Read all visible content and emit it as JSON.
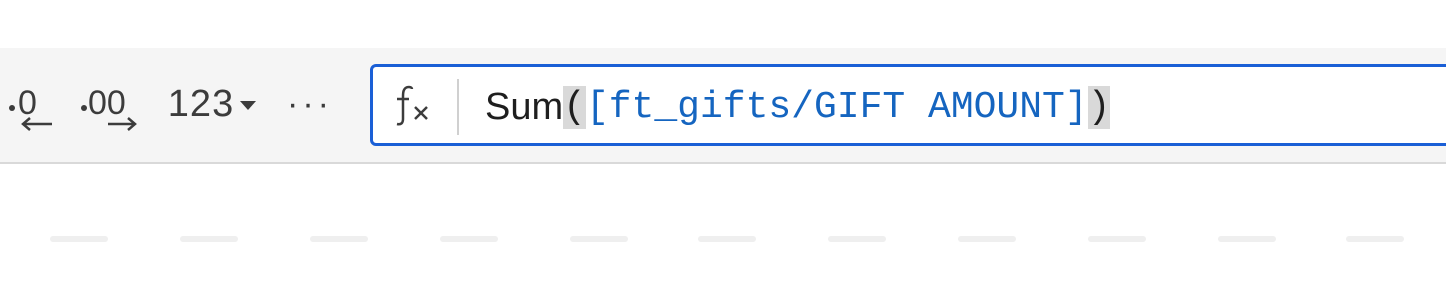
{
  "toolbar": {
    "decrease_decimal_icon": "decrease-decimal-icon",
    "increase_decimal_icon": "increase-decimal-icon",
    "number_format_label": "123",
    "more_label": "···"
  },
  "formula_bar": {
    "fx_icon": "function-fx-icon",
    "function_name": "Sum",
    "open_paren": "(",
    "reference": "[ft_gifts/GIFT AMOUNT]",
    "close_paren": ")"
  },
  "colors": {
    "accent": "#1a5fd6",
    "reference_text": "#1565c0",
    "toolbar_bg": "#f5f5f5",
    "paren_highlight": "#d9d9d9"
  }
}
